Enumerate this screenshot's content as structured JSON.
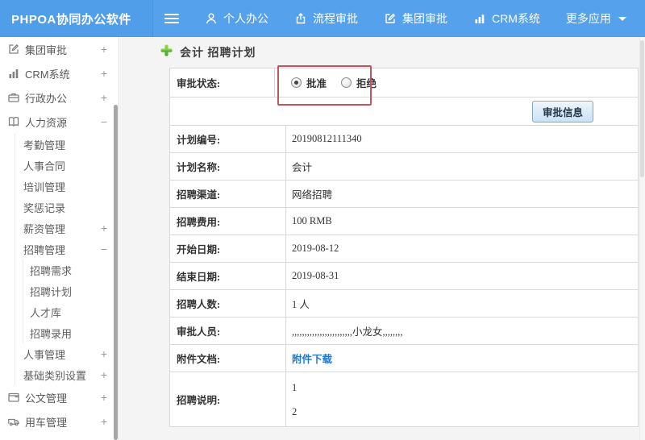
{
  "colors": {
    "topbar_bg": "#55a1eb",
    "brand_bg": "#509de9",
    "annotation_red": "#c0555a",
    "link_blue": "#2277cc",
    "button_bg": "#cbe2f6",
    "button_border": "#83a6c6",
    "plus_green": "#4caf2f",
    "sidebar_scrollbar": "#a6a6a6"
  },
  "topbar": {
    "brand": "PHPOA协同办公软件",
    "nav": [
      {
        "label": "个人办公",
        "icon": "user-icon"
      },
      {
        "label": "流程审批",
        "icon": "process-icon"
      },
      {
        "label": "集团审批",
        "icon": "edit-square-icon"
      },
      {
        "label": "CRM系统",
        "icon": "bar-chart-icon"
      },
      {
        "label": "更多应用",
        "icon": "caret-down-icon"
      }
    ]
  },
  "sidebar": {
    "items": [
      {
        "label": "集团审批",
        "level": 1,
        "icon": "edit-square-icon",
        "toggle": "+"
      },
      {
        "label": "CRM系统",
        "level": 1,
        "icon": "bar-chart-icon",
        "toggle": "+"
      },
      {
        "label": "行政办公",
        "level": 1,
        "icon": "briefcase-icon",
        "toggle": "+"
      },
      {
        "label": "人力资源",
        "level": 1,
        "icon": "book-icon",
        "toggle": "−",
        "expanded": true
      },
      {
        "label": "考勤管理",
        "level": 2
      },
      {
        "label": "人事合同",
        "level": 2
      },
      {
        "label": "培训管理",
        "level": 2
      },
      {
        "label": "奖惩记录",
        "level": 2
      },
      {
        "label": "薪资管理",
        "level": 2,
        "toggle": "+"
      },
      {
        "label": "招聘管理",
        "level": 2,
        "toggle": "−",
        "expanded": true
      },
      {
        "label": "招聘需求",
        "level": 3
      },
      {
        "label": "招聘计划",
        "level": 3
      },
      {
        "label": "人才库",
        "level": 3
      },
      {
        "label": "招聘录用",
        "level": 3
      },
      {
        "label": "人事管理",
        "level": 2,
        "toggle": "+"
      },
      {
        "label": "基础类别设置",
        "level": 2,
        "toggle": "+"
      },
      {
        "label": "公文管理",
        "level": 1,
        "icon": "document-icon",
        "toggle": "+"
      },
      {
        "label": "用车管理",
        "level": 1,
        "icon": "car-icon",
        "toggle": "+"
      }
    ]
  },
  "main": {
    "page_title": "会计 招聘计划",
    "approval": {
      "status_label": "审批状态:",
      "options": [
        {
          "label": "批准",
          "selected": true
        },
        {
          "label": "拒绝",
          "selected": false
        }
      ],
      "info_button": "审批信息"
    },
    "form": {
      "rows": [
        {
          "label": "计划编号:",
          "value": "20190812111340"
        },
        {
          "label": "计划名称:",
          "value": "会计"
        },
        {
          "label": "招聘渠道:",
          "value": "网络招聘"
        },
        {
          "label": "招聘费用:",
          "value": "100 RMB"
        },
        {
          "label": "开始日期:",
          "value": "2019-08-12"
        },
        {
          "label": "结束日期:",
          "value": "2019-08-31"
        },
        {
          "label": "招聘人数:",
          "value": "1 人"
        },
        {
          "label": "审批人员:",
          "value": ",,,,,,,,,,,,,,,,,,,,,,,,小龙女,,,,,,,,"
        },
        {
          "label": "附件文档:",
          "value": "附件下载"
        },
        {
          "label": "招聘说明:",
          "value": "1\n2"
        }
      ]
    }
  }
}
